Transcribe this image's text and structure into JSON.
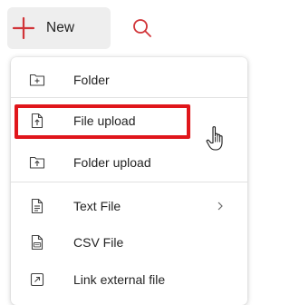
{
  "toolbar": {
    "new_label": "New",
    "new_icon": "plus-icon",
    "search_icon": "search-icon",
    "accent_color": "#d13438"
  },
  "menu": {
    "items": [
      {
        "label": "Folder",
        "icon": "folder-add-icon"
      },
      {
        "label": "File upload",
        "icon": "file-upload-icon"
      },
      {
        "label": "Folder upload",
        "icon": "folder-upload-icon"
      },
      {
        "label": "Text File",
        "icon": "text-file-icon",
        "has_submenu": true
      },
      {
        "label": "CSV File",
        "icon": "csv-file-icon"
      },
      {
        "label": "Link external file",
        "icon": "link-external-icon"
      }
    ]
  },
  "annotation": {
    "highlight_color": "#e0161b",
    "highlighted_item": "File upload",
    "cursor": "hand-pointer-icon"
  }
}
